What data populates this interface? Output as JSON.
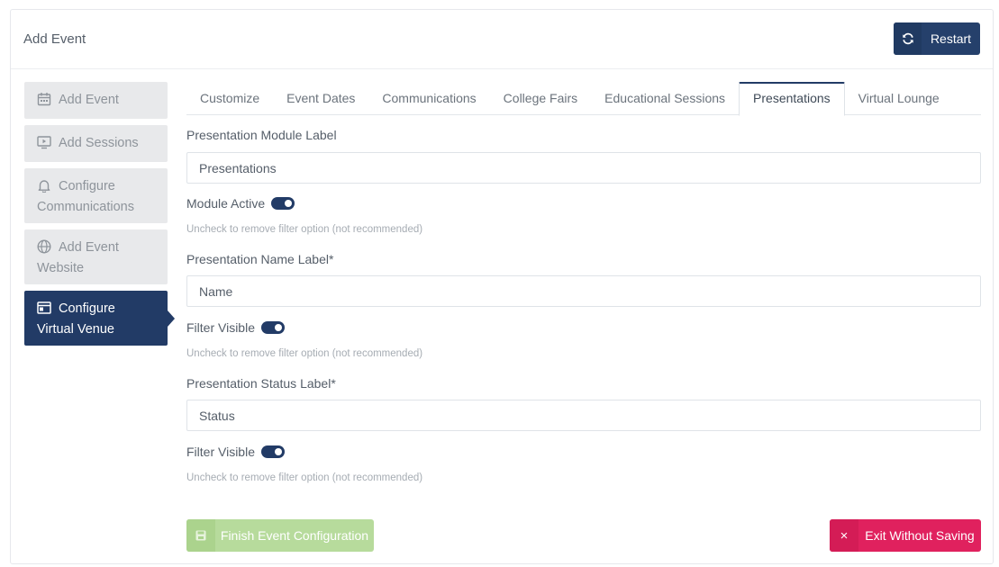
{
  "header": {
    "title": "Add Event",
    "restart_label": "Restart"
  },
  "sidebar": {
    "items": [
      {
        "icon": "calendar-icon",
        "label": "Add Event",
        "active": false
      },
      {
        "icon": "video-screen-icon",
        "label": "Add Sessions",
        "active": false
      },
      {
        "icon": "bell-icon",
        "line1": "Configure",
        "line2": "Communications",
        "active": false
      },
      {
        "icon": "globe-icon",
        "line1": "Add Event",
        "line2": "Website",
        "active": false
      },
      {
        "icon": "window-icon",
        "line1": "Configure",
        "line2": "Virtual Venue",
        "active": true
      }
    ]
  },
  "tabs": [
    "Customize",
    "Event Dates",
    "Communications",
    "College Fairs",
    "Educational Sessions",
    "Presentations",
    "Virtual Lounge"
  ],
  "active_tab": "Presentations",
  "form": {
    "module_label": {
      "label": "Presentation Module Label",
      "value": "Presentations"
    },
    "module_active": {
      "label": "Module Active",
      "checked": true,
      "help": "Uncheck to remove filter option (not recommended)"
    },
    "name_label": {
      "label": "Presentation Name Label*",
      "value": "Name"
    },
    "name_filter": {
      "label": "Filter Visible",
      "checked": true,
      "help": "Uncheck to remove filter option (not recommended)"
    },
    "status_label": {
      "label": "Presentation Status Label*",
      "value": "Status"
    },
    "status_filter": {
      "label": "Filter Visible",
      "checked": true,
      "help": "Uncheck to remove filter option (not recommended)"
    }
  },
  "footer": {
    "finish_label": "Finish Event Configuration",
    "exit_label": "Exit Without Saving",
    "exit_icon": "×"
  },
  "colors": {
    "primary": "#223b66",
    "success_disabled": "#b7db9c",
    "danger": "#e0215e"
  }
}
